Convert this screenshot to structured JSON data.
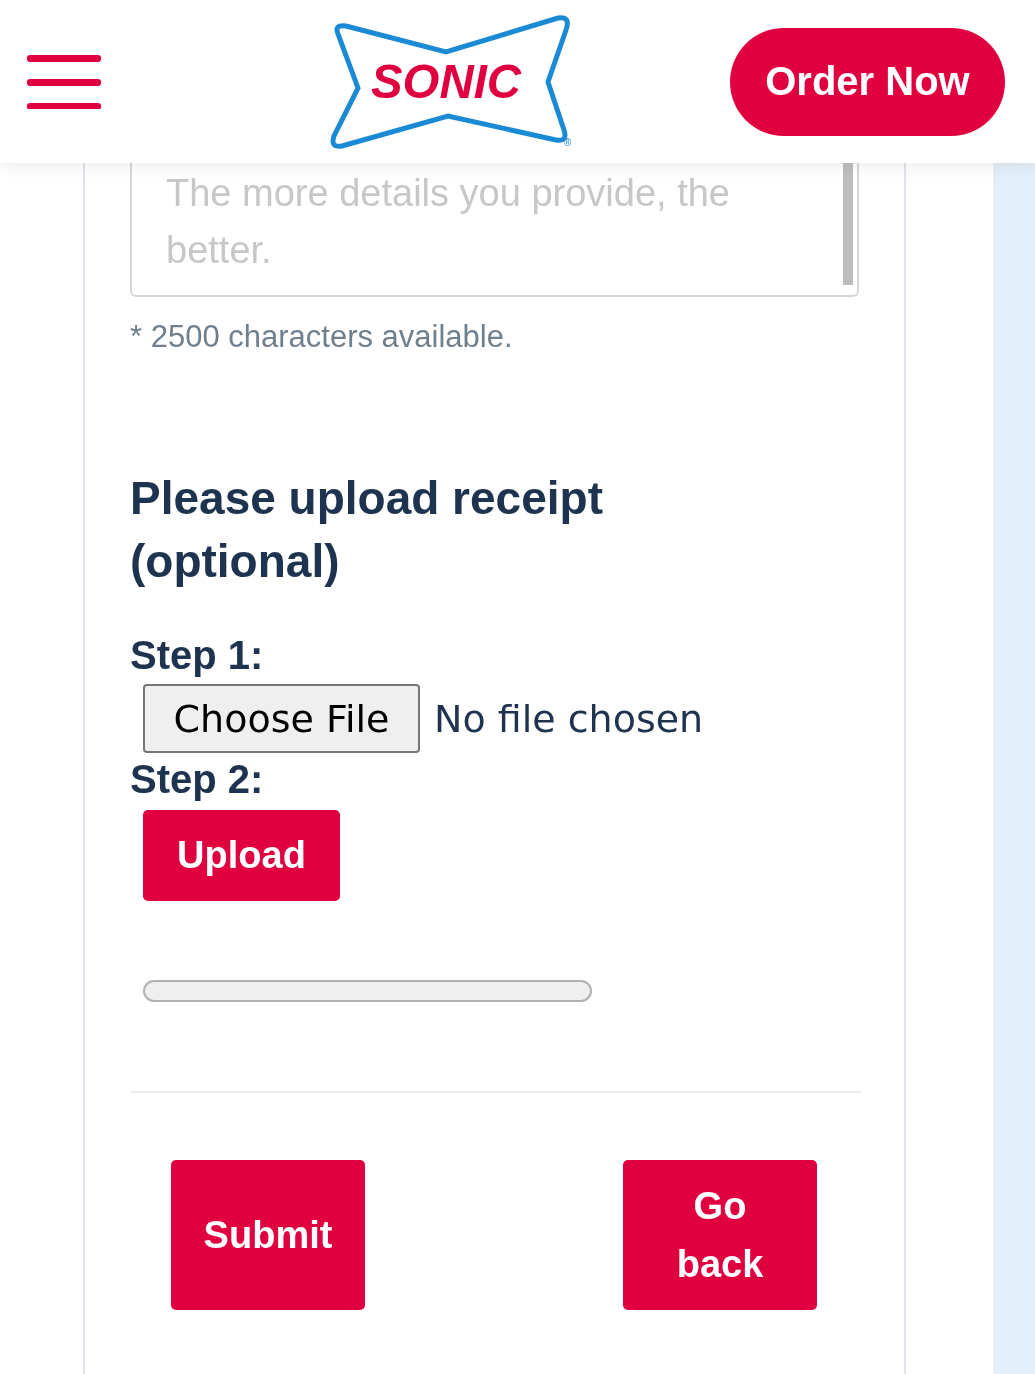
{
  "header": {
    "logo": {
      "text": "SONIC",
      "mark": "®"
    },
    "order_button": "Order Now"
  },
  "details_field": {
    "placeholder": "The more details you provide, the better."
  },
  "characters_note": "* 2500 characters available.",
  "upload": {
    "title": "Please upload receipt (optional)",
    "steps": [
      {
        "kind": "file",
        "label": "Step 1:",
        "button": "Choose File",
        "status": "No file chosen"
      },
      {
        "kind": "upload",
        "label": "Step 2:",
        "button": "Upload"
      }
    ],
    "progress": {
      "level": 0
    }
  },
  "actions": [
    "Submit",
    "Go back"
  ]
}
